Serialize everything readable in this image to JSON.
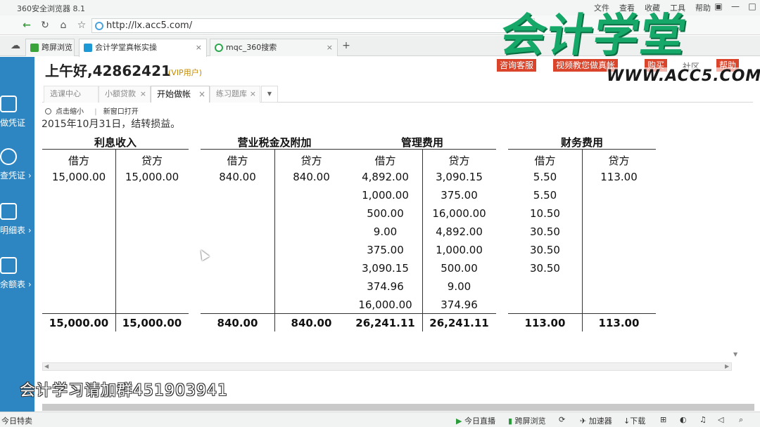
{
  "browser": {
    "title": "360安全浏览器 8.1",
    "menus": [
      "文件",
      "查看",
      "收藏",
      "工具",
      "帮助"
    ],
    "url": "http://lx.acc5.com/",
    "tabs": [
      {
        "label": "跨屏浏览"
      },
      {
        "label": "会计学堂真帐实操"
      },
      {
        "label": "mqc_360搜索"
      }
    ]
  },
  "watermark": {
    "brand": "会计学堂",
    "url": "WWW.ACC5.COM"
  },
  "sidebar": {
    "items": [
      {
        "label": "做凭证"
      },
      {
        "label": "查凭证 ›"
      },
      {
        "label": "明细表 ›"
      },
      {
        "label": "余额表 ›"
      }
    ]
  },
  "header": {
    "greeting": "上午好,42862421",
    "vip": "(VIP用户)",
    "btn_consult": "咨询客服",
    "btn_video": "视频教您做真帐",
    "btn_buy": "购买",
    "link_community": "社区",
    "btn_help": "帮助"
  },
  "inner_tabs": [
    {
      "label": "选课中心"
    },
    {
      "label": "小额贷款"
    },
    {
      "label": "开始做帐"
    },
    {
      "label": "练习题库"
    }
  ],
  "toolbar": {
    "zoom_out": "点击缩小",
    "new_window": "新窗口打开"
  },
  "document": {
    "title": "2015年10月31日，结转损益。",
    "debit_label": "借方",
    "credit_label": "贷方",
    "accounts": [
      {
        "name": "利息收入",
        "debit": [
          "15,000.00"
        ],
        "credit": [
          "15,000.00"
        ],
        "debit_total": "15,000.00",
        "credit_total": "15,000.00"
      },
      {
        "name": "营业税金及附加",
        "debit": [
          "840.00"
        ],
        "credit": [
          "840.00"
        ],
        "debit_total": "840.00",
        "credit_total": "840.00"
      },
      {
        "name": "管理费用",
        "debit": [
          "4,892.00",
          "1,000.00",
          "500.00",
          "9.00",
          "375.00",
          "3,090.15",
          "374.96",
          "16,000.00"
        ],
        "credit": [
          "3,090.15",
          "375.00",
          "16,000.00",
          "4,892.00",
          "1,000.00",
          "500.00",
          "9.00",
          "374.96"
        ],
        "debit_total": "26,241.11",
        "credit_total": "26,241.11"
      },
      {
        "name": "财务费用",
        "debit": [
          "5.50",
          "5.50",
          "10.50",
          "30.50",
          "30.50",
          "30.50"
        ],
        "credit": [
          "113.00"
        ],
        "debit_total": "113.00",
        "credit_total": "113.00"
      }
    ]
  },
  "overlay": {
    "qq_group": "会计学习请加群451903941"
  },
  "statusbar": {
    "left": "今日特卖",
    "live": "今日直播",
    "cross": "跨屏浏览",
    "accel": "加速器",
    "download": "下载"
  }
}
